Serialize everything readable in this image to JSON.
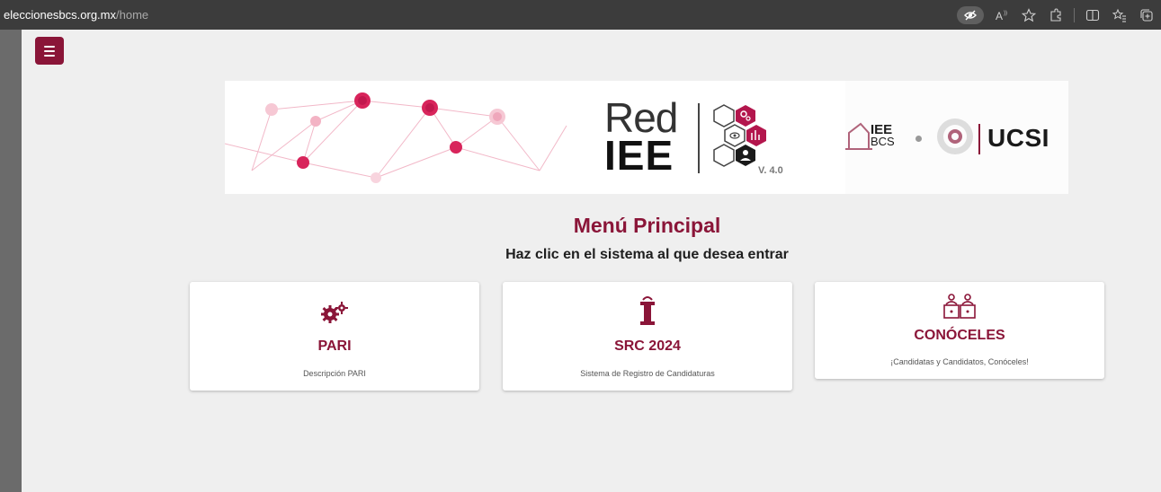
{
  "browser": {
    "url_host": "eleccionesbcs.org.mx",
    "url_path": "/home"
  },
  "banner": {
    "red": "Red",
    "iee": "IEE",
    "version": "V. 4.0",
    "iee_bcs_top": "IEE",
    "iee_bcs_bottom": "BCS",
    "ucsi": "UCSI"
  },
  "page": {
    "title": "Menú Principal",
    "subtitle": "Haz clic en el sistema al que desea entrar"
  },
  "cards": [
    {
      "name": "PARI",
      "description": "Descripción PARI",
      "icon": "gears-icon"
    },
    {
      "name": "SRC 2024",
      "description": "Sistema de Registro de Candidaturas",
      "icon": "podium-icon"
    },
    {
      "name": "CONÓCELES",
      "description": "¡Candidatas y Candidatos, Conóceles!",
      "icon": "candidates-icon"
    }
  ],
  "colors": {
    "accent": "#8a1538",
    "background": "#efefef",
    "card": "#ffffff"
  }
}
